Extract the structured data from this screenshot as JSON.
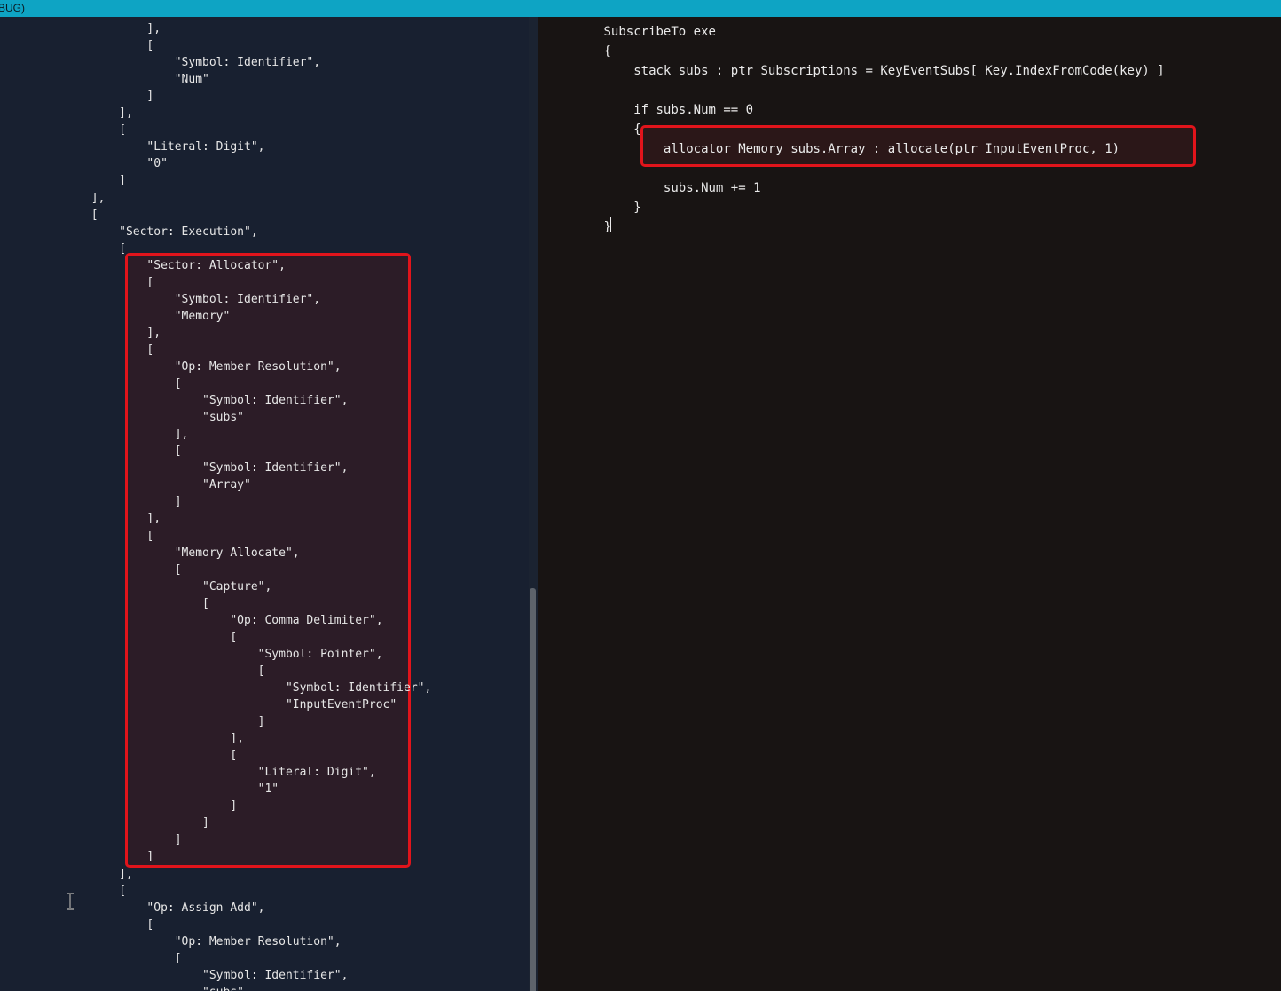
{
  "window": {
    "title": "BUG)"
  },
  "ast_panel": {
    "lines": [
      "            ],",
      "            [",
      "                \"Symbol: Identifier\",",
      "                \"Num\"",
      "            ]",
      "        ],",
      "        [",
      "            \"Literal: Digit\",",
      "            \"0\"",
      "        ]",
      "    ],",
      "    [",
      "        \"Sector: Execution\",",
      "        [",
      "            \"Sector: Allocator\",",
      "            [",
      "                \"Symbol: Identifier\",",
      "                \"Memory\"",
      "            ],",
      "            [",
      "                \"Op: Member Resolution\",",
      "                [",
      "                    \"Symbol: Identifier\",",
      "                    \"subs\"",
      "                ],",
      "                [",
      "                    \"Symbol: Identifier\",",
      "                    \"Array\"",
      "                ]",
      "            ],",
      "            [",
      "                \"Memory Allocate\",",
      "                [",
      "                    \"Capture\",",
      "                    [",
      "                        \"Op: Comma Delimiter\",",
      "                        [",
      "                            \"Symbol: Pointer\",",
      "                            [",
      "                                \"Symbol: Identifier\",",
      "                                \"InputEventProc\"",
      "                            ]",
      "                        ],",
      "                        [",
      "                            \"Literal: Digit\",",
      "                            \"1\"",
      "                        ]",
      "                    ]",
      "                ]",
      "            ]",
      "        ],",
      "        [",
      "            \"Op: Assign Add\",",
      "            [",
      "                \"Op: Member Resolution\",",
      "                [",
      "                    \"Symbol: Identifier\",",
      "                    \"subs\""
    ]
  },
  "source_panel": {
    "lines": [
      "SubscribeTo exe",
      "{",
      "    stack subs : ptr Subscriptions = KeyEventSubs[ Key.IndexFromCode(key) ]",
      "",
      "    if subs.Num == 0",
      "    {",
      "        allocator Memory subs.Array : allocate(ptr InputEventProc, 1)",
      "",
      "        subs.Num += 1",
      "    }",
      "}"
    ]
  },
  "colors": {
    "title_bar": "#0ea4c4",
    "highlight_border": "#e1141b",
    "left_background": "#182030",
    "right_background": "#181413"
  },
  "icons": {
    "cursor": "text-cursor-ibeam-icon"
  }
}
